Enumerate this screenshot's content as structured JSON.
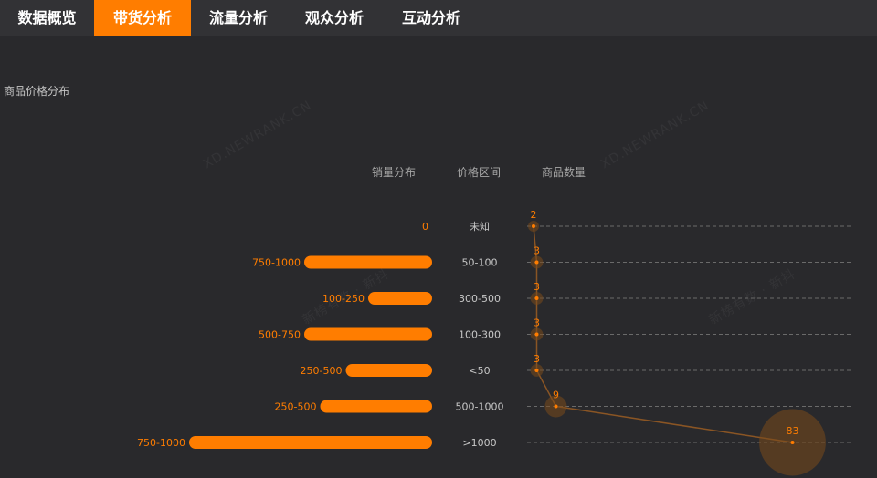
{
  "tabs": [
    {
      "label": "数据概览",
      "active": false
    },
    {
      "label": "带货分析",
      "active": true
    },
    {
      "label": "流量分析",
      "active": false
    },
    {
      "label": "观众分析",
      "active": false
    },
    {
      "label": "互动分析",
      "active": false
    }
  ],
  "section_title": "商品价格分布",
  "headers": {
    "sales": "销量分布",
    "price": "价格区间",
    "count": "商品数量"
  },
  "watermarks": [
    "XD.NEWRANK.CN",
    "XD.NEWRANK.CN",
    "新榜有数 · 新抖",
    "新榜有数 · 新抖"
  ],
  "colors": {
    "accent": "#ff7d00",
    "grid": "#6a6a6a",
    "bubble": "#7a4a1c"
  },
  "chart_data": {
    "type": "bar",
    "categories": [
      "未知",
      "50-100",
      "300-500",
      "100-300",
      "<50",
      "500-1000",
      ">1000"
    ],
    "series": [
      {
        "name": "销量分布",
        "values": [
          0,
          2,
          1,
          2,
          1.35,
          1.75,
          3.8
        ],
        "labels": [
          "0",
          "750-1000",
          "100-250",
          "500-750",
          "250-500",
          "250-500",
          "750-1000"
        ]
      },
      {
        "name": "商品数量",
        "values": [
          2,
          3,
          3,
          3,
          3,
          9,
          83
        ]
      }
    ],
    "count_range": [
      0,
      100
    ]
  }
}
